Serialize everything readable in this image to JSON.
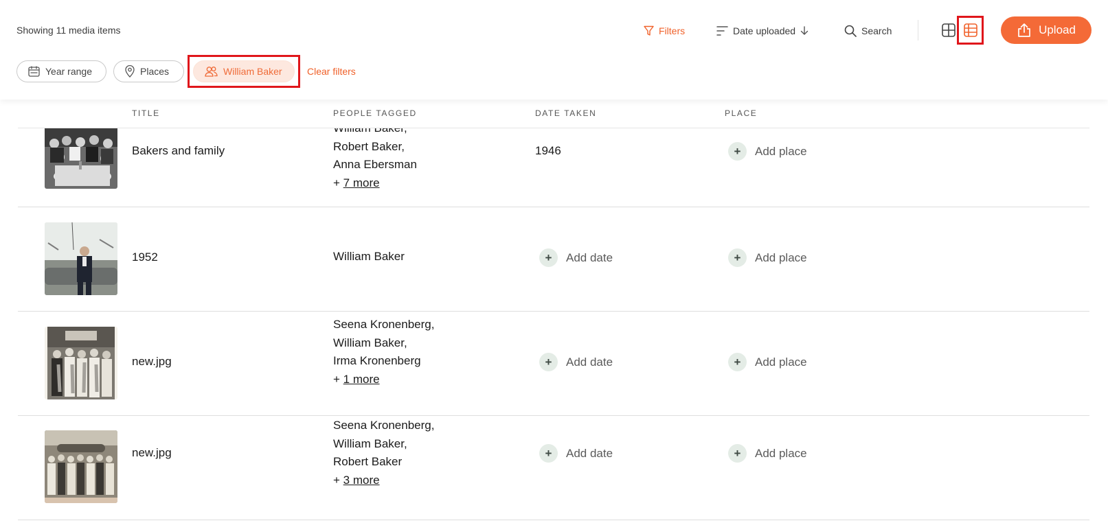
{
  "toolbar": {
    "count_text": "Showing 11 media items",
    "filters_label": "Filters",
    "sort_label": "Date uploaded",
    "search_label": "Search",
    "upload_label": "Upload",
    "accent_color": "#f46a37"
  },
  "chips": {
    "year_range": "Year range",
    "places": "Places",
    "person": "William Baker",
    "clear": "Clear filters"
  },
  "table": {
    "headers": {
      "title": "TITLE",
      "people": "PEOPLE TAGGED",
      "date": "DATE TAKEN",
      "place": "PLACE"
    },
    "add_date_label": "Add date",
    "add_place_label": "Add place",
    "rows": [
      {
        "title": "Bakers and family",
        "people": [
          "William Baker,",
          "Robert Baker,",
          "Anna Ebersman"
        ],
        "more_prefix": "+ ",
        "more_link": "7 more",
        "date": "1946"
      },
      {
        "title": "1952",
        "people": [
          "William Baker"
        ],
        "date": ""
      },
      {
        "title": "new.jpg",
        "people": [
          "Seena Kronenberg,",
          "William Baker,",
          "Irma Kronenberg"
        ],
        "more_prefix": "+ ",
        "more_link": "1 more",
        "date": ""
      },
      {
        "title": "new.jpg",
        "people": [
          "Seena Kronenberg,",
          "William Baker,",
          "Robert Baker"
        ],
        "more_prefix": "+ ",
        "more_link": "3 more",
        "date": ""
      }
    ]
  }
}
